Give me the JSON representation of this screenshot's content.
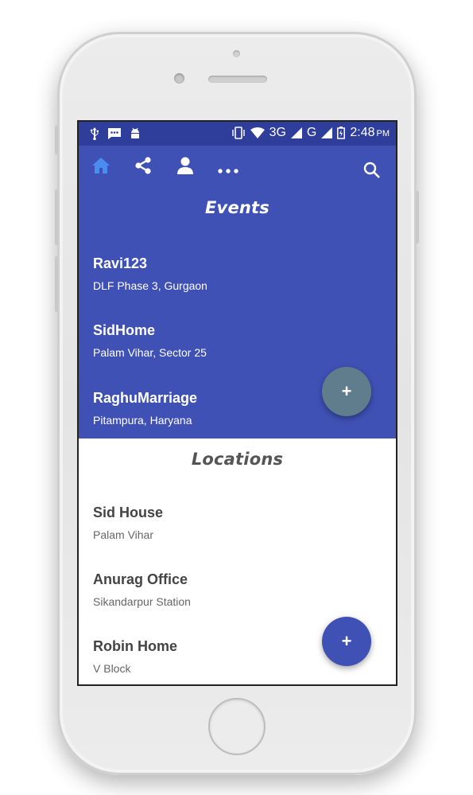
{
  "status_bar": {
    "network_label_1": "3G",
    "network_label_2": "G",
    "time": "2:48",
    "ampm": "PM",
    "left_icons": [
      "usb-icon",
      "message-icon",
      "android-icon"
    ],
    "right_icons": [
      "vibrate-icon",
      "wifi-icon",
      "signal-icon",
      "battery-icon"
    ]
  },
  "toolbar": {
    "icons": [
      "home-icon",
      "share-icon",
      "person-icon",
      "more-icon",
      "search-icon"
    ],
    "active_color": "#4a8df0"
  },
  "events": {
    "title": "Events",
    "background": "#3f51b5",
    "items": [
      {
        "name": "Ravi123",
        "address": "DLF Phase 3, Gurgaon"
      },
      {
        "name": "SidHome",
        "address": "Palam Vihar, Sector 25"
      },
      {
        "name": "RaghuMarriage",
        "address": "Pitampura, Haryana"
      }
    ],
    "fab_label": "+",
    "fab_color": "#5f7d8c"
  },
  "locations": {
    "title": "Locations",
    "items": [
      {
        "name": "Sid House",
        "address": "Palam Vihar"
      },
      {
        "name": "Anurag Office",
        "address": "Sikandarpur Station"
      },
      {
        "name": "Robin Home",
        "address": "V Block"
      }
    ],
    "fab_label": "+",
    "fab_color": "#3f51b5"
  }
}
